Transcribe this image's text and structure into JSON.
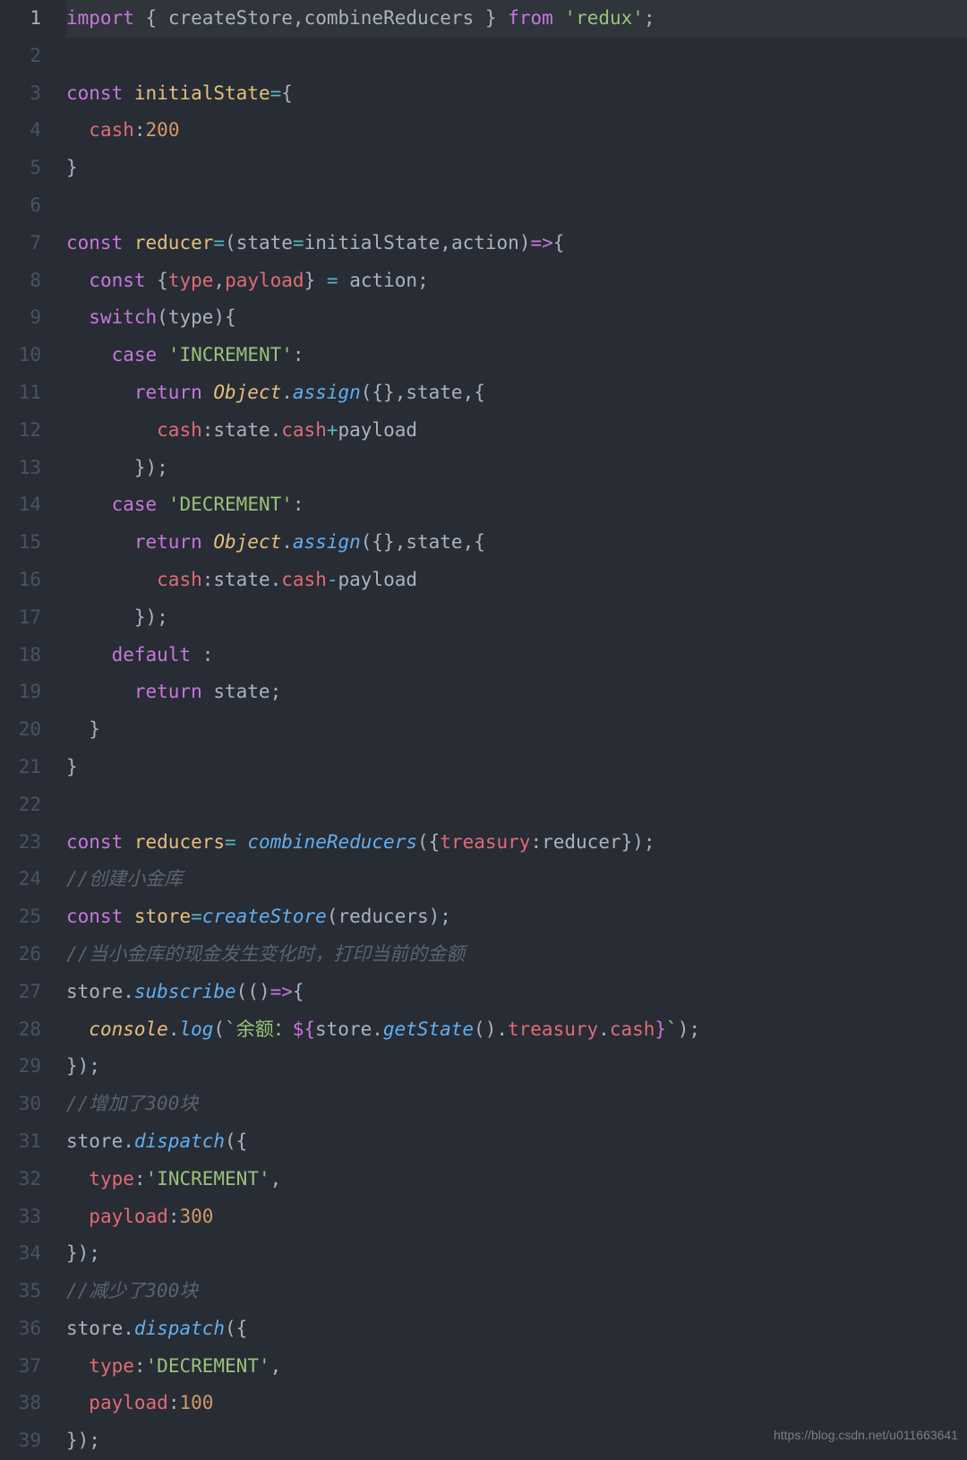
{
  "watermark": "https://blog.csdn.net/u011663641",
  "active_line_index": 0,
  "gutter": [
    "1",
    "2",
    "3",
    "4",
    "5",
    "6",
    "7",
    "8",
    "9",
    "10",
    "11",
    "12",
    "13",
    "14",
    "15",
    "16",
    "17",
    "18",
    "19",
    "20",
    "21",
    "22",
    "23",
    "24",
    "25",
    "26",
    "27",
    "28",
    "29",
    "30",
    "31",
    "32",
    "33",
    "34",
    "35",
    "36",
    "37",
    "38",
    "39"
  ],
  "code": {
    "plain_source": "import { createStore,combineReducers } from 'redux';\n\nconst initialState={\n  cash:200\n}\n\nconst reducer=(state=initialState,action)=>{\n  const {type,payload} = action;\n  switch(type){\n    case 'INCREMENT':\n      return Object.assign({},state,{\n        cash:state.cash+payload\n      });\n    case 'DECREMENT':\n      return Object.assign({},state,{\n        cash:state.cash-payload\n      });\n    default :\n      return state;\n  }\n}\n\nconst reducers= combineReducers({treasury:reducer});\n//创建小金库\nconst store=createStore(reducers);\n//当小金库的现金发生变化时，打印当前的金额\nstore.subscribe(()=>{\n  console.log(`余额：${store.getState().treasury.cash}`);\n});\n//增加了300块\nstore.dispatch({\n  type:'INCREMENT',\n  payload:300\n});\n//减少了300块\nstore.dispatch({\n  type:'DECREMENT',\n  payload:100\n});",
    "lines": [
      {
        "hl": true,
        "tokens": [
          [
            "kw",
            "import"
          ],
          [
            "def",
            " "
          ],
          [
            "def",
            "{"
          ],
          [
            "def",
            " "
          ],
          [
            "def",
            "createStore"
          ],
          [
            "def",
            ","
          ],
          [
            "def",
            "combineReducers"
          ],
          [
            "def",
            " "
          ],
          [
            "def",
            "}"
          ],
          [
            "def",
            " "
          ],
          [
            "kw",
            "from"
          ],
          [
            "def",
            " "
          ],
          [
            "str",
            "'redux'"
          ],
          [
            "def",
            ";"
          ]
        ]
      },
      {
        "tokens": []
      },
      {
        "tokens": [
          [
            "kw",
            "const"
          ],
          [
            "def",
            " "
          ],
          [
            "id",
            "initialState"
          ],
          [
            "op",
            "="
          ],
          [
            "def",
            "{"
          ]
        ]
      },
      {
        "tokens": [
          [
            "def",
            "  "
          ],
          [
            "prop",
            "cash"
          ],
          [
            "def",
            ":"
          ],
          [
            "num",
            "200"
          ]
        ]
      },
      {
        "tokens": [
          [
            "def",
            "}"
          ]
        ]
      },
      {
        "tokens": []
      },
      {
        "tokens": [
          [
            "kw",
            "const"
          ],
          [
            "def",
            " "
          ],
          [
            "id",
            "reducer"
          ],
          [
            "op",
            "="
          ],
          [
            "def",
            "("
          ],
          [
            "pl",
            "state"
          ],
          [
            "op",
            "="
          ],
          [
            "def",
            "initialState"
          ],
          [
            "def",
            ","
          ],
          [
            "pl",
            "action"
          ],
          [
            "def",
            ")"
          ],
          [
            "kw",
            "=>"
          ],
          [
            "def",
            "{"
          ]
        ]
      },
      {
        "tokens": [
          [
            "def",
            "  "
          ],
          [
            "kw",
            "const"
          ],
          [
            "def",
            " "
          ],
          [
            "def",
            "{"
          ],
          [
            "prop",
            "type"
          ],
          [
            "def",
            ","
          ],
          [
            "prop",
            "payload"
          ],
          [
            "def",
            "}"
          ],
          [
            "def",
            " "
          ],
          [
            "op",
            "="
          ],
          [
            "def",
            " action"
          ],
          [
            "def",
            ";"
          ]
        ]
      },
      {
        "tokens": [
          [
            "def",
            "  "
          ],
          [
            "kw",
            "switch"
          ],
          [
            "def",
            "("
          ],
          [
            "def",
            "type"
          ],
          [
            "def",
            "){"
          ]
        ]
      },
      {
        "tokens": [
          [
            "def",
            "    "
          ],
          [
            "kw",
            "case"
          ],
          [
            "def",
            " "
          ],
          [
            "str",
            "'INCREMENT'"
          ],
          [
            "def",
            ":"
          ]
        ]
      },
      {
        "tokens": [
          [
            "def",
            "      "
          ],
          [
            "kw",
            "return"
          ],
          [
            "def",
            " "
          ],
          [
            "obj",
            "Object"
          ],
          [
            "def",
            "."
          ],
          [
            "fn",
            "assign"
          ],
          [
            "def",
            "({}"
          ],
          [
            "def",
            ","
          ],
          [
            "def",
            "state"
          ],
          [
            "def",
            ","
          ],
          [
            "def",
            "{"
          ]
        ]
      },
      {
        "tokens": [
          [
            "def",
            "        "
          ],
          [
            "prop",
            "cash"
          ],
          [
            "def",
            ":"
          ],
          [
            "def",
            "state"
          ],
          [
            "def",
            "."
          ],
          [
            "prop",
            "cash"
          ],
          [
            "op",
            "+"
          ],
          [
            "def",
            "payload"
          ]
        ]
      },
      {
        "tokens": [
          [
            "def",
            "      });"
          ]
        ]
      },
      {
        "tokens": [
          [
            "def",
            "    "
          ],
          [
            "kw",
            "case"
          ],
          [
            "def",
            " "
          ],
          [
            "str",
            "'DECREMENT'"
          ],
          [
            "def",
            ":"
          ]
        ]
      },
      {
        "tokens": [
          [
            "def",
            "      "
          ],
          [
            "kw",
            "return"
          ],
          [
            "def",
            " "
          ],
          [
            "obj",
            "Object"
          ],
          [
            "def",
            "."
          ],
          [
            "fn",
            "assign"
          ],
          [
            "def",
            "({}"
          ],
          [
            "def",
            ","
          ],
          [
            "def",
            "state"
          ],
          [
            "def",
            ","
          ],
          [
            "def",
            "{"
          ]
        ]
      },
      {
        "tokens": [
          [
            "def",
            "        "
          ],
          [
            "prop",
            "cash"
          ],
          [
            "def",
            ":"
          ],
          [
            "def",
            "state"
          ],
          [
            "def",
            "."
          ],
          [
            "prop",
            "cash"
          ],
          [
            "op",
            "-"
          ],
          [
            "def",
            "payload"
          ]
        ]
      },
      {
        "tokens": [
          [
            "def",
            "      });"
          ]
        ]
      },
      {
        "tokens": [
          [
            "def",
            "    "
          ],
          [
            "kw",
            "default"
          ],
          [
            "def",
            " :"
          ]
        ]
      },
      {
        "tokens": [
          [
            "def",
            "      "
          ],
          [
            "kw",
            "return"
          ],
          [
            "def",
            " state"
          ],
          [
            "def",
            ";"
          ]
        ]
      },
      {
        "tokens": [
          [
            "def",
            "  }"
          ]
        ]
      },
      {
        "tokens": [
          [
            "def",
            "}"
          ]
        ]
      },
      {
        "tokens": []
      },
      {
        "tokens": [
          [
            "kw",
            "const"
          ],
          [
            "def",
            " "
          ],
          [
            "id",
            "reducers"
          ],
          [
            "op",
            "="
          ],
          [
            "def",
            " "
          ],
          [
            "fn",
            "combineReducers"
          ],
          [
            "def",
            "({"
          ],
          [
            "prop",
            "treasury"
          ],
          [
            "def",
            ":"
          ],
          [
            "def",
            "reducer"
          ],
          [
            "def",
            "});"
          ]
        ]
      },
      {
        "tokens": [
          [
            "cmt",
            "//创建小金库"
          ]
        ]
      },
      {
        "tokens": [
          [
            "kw",
            "const"
          ],
          [
            "def",
            " "
          ],
          [
            "id",
            "store"
          ],
          [
            "op",
            "="
          ],
          [
            "fn",
            "createStore"
          ],
          [
            "def",
            "("
          ],
          [
            "def",
            "reducers"
          ],
          [
            "def",
            ");"
          ]
        ]
      },
      {
        "tokens": [
          [
            "cmt",
            "//当小金库的现金发生变化时，打印当前的金额"
          ]
        ]
      },
      {
        "tokens": [
          [
            "def",
            "store"
          ],
          [
            "def",
            "."
          ],
          [
            "fn",
            "subscribe"
          ],
          [
            "def",
            "(()"
          ],
          [
            "kw",
            "=>"
          ],
          [
            "def",
            "{"
          ]
        ]
      },
      {
        "tokens": [
          [
            "def",
            "  "
          ],
          [
            "obj",
            "console"
          ],
          [
            "def",
            "."
          ],
          [
            "fn",
            "log"
          ],
          [
            "def",
            "("
          ],
          [
            "str",
            "`余额："
          ],
          [
            "kw",
            "${"
          ],
          [
            "def",
            "store"
          ],
          [
            "def",
            "."
          ],
          [
            "fn",
            "getState"
          ],
          [
            "def",
            "()"
          ],
          [
            "def",
            "."
          ],
          [
            "prop",
            "treasury"
          ],
          [
            "def",
            "."
          ],
          [
            "prop",
            "cash"
          ],
          [
            "kw",
            "}"
          ],
          [
            "str",
            "`"
          ],
          [
            "def",
            ");"
          ]
        ]
      },
      {
        "tokens": [
          [
            "def",
            "});"
          ]
        ]
      },
      {
        "tokens": [
          [
            "cmt",
            "//增加了300块"
          ]
        ]
      },
      {
        "tokens": [
          [
            "def",
            "store"
          ],
          [
            "def",
            "."
          ],
          [
            "fn",
            "dispatch"
          ],
          [
            "def",
            "({"
          ]
        ]
      },
      {
        "tokens": [
          [
            "def",
            "  "
          ],
          [
            "prop",
            "type"
          ],
          [
            "def",
            ":"
          ],
          [
            "str",
            "'INCREMENT'"
          ],
          [
            "def",
            ","
          ]
        ]
      },
      {
        "tokens": [
          [
            "def",
            "  "
          ],
          [
            "prop",
            "payload"
          ],
          [
            "def",
            ":"
          ],
          [
            "num",
            "300"
          ]
        ]
      },
      {
        "tokens": [
          [
            "def",
            "});"
          ]
        ]
      },
      {
        "tokens": [
          [
            "cmt",
            "//减少了300块"
          ]
        ]
      },
      {
        "tokens": [
          [
            "def",
            "store"
          ],
          [
            "def",
            "."
          ],
          [
            "fn",
            "dispatch"
          ],
          [
            "def",
            "({"
          ]
        ]
      },
      {
        "tokens": [
          [
            "def",
            "  "
          ],
          [
            "prop",
            "type"
          ],
          [
            "def",
            ":"
          ],
          [
            "str",
            "'DECREMENT'"
          ],
          [
            "def",
            ","
          ]
        ]
      },
      {
        "tokens": [
          [
            "def",
            "  "
          ],
          [
            "prop",
            "payload"
          ],
          [
            "def",
            ":"
          ],
          [
            "num",
            "100"
          ]
        ]
      },
      {
        "tokens": [
          [
            "def",
            "});"
          ]
        ]
      }
    ]
  }
}
